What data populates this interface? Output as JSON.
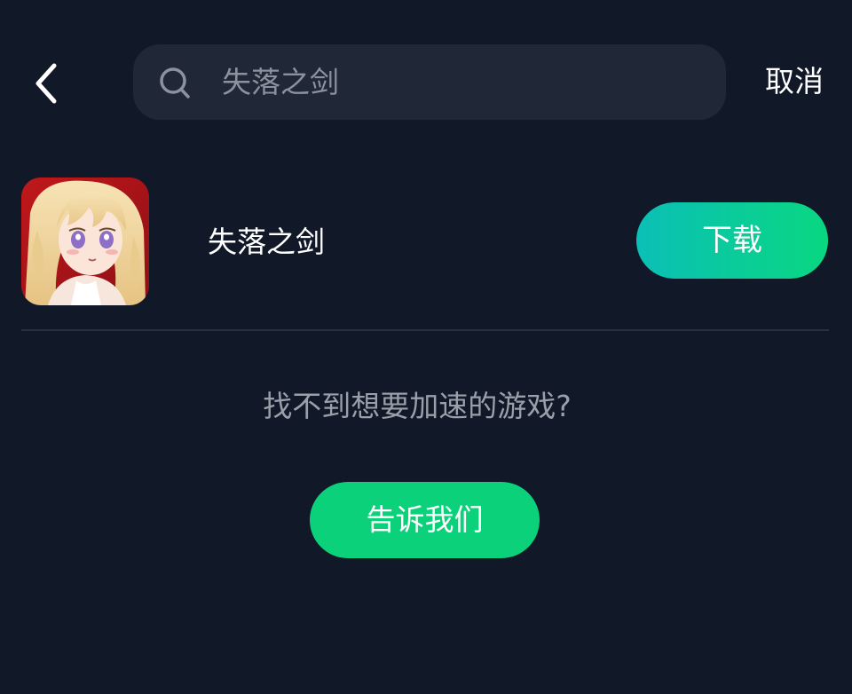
{
  "header": {
    "back_icon": "chevron-left-icon",
    "search": {
      "icon": "search-icon",
      "value": "失落之剑",
      "placeholder": ""
    },
    "cancel_label": "取消"
  },
  "results": [
    {
      "title": "失落之剑",
      "icon": "anime-character-game-icon",
      "action_label": "下载"
    }
  ],
  "empty_prompt": {
    "text": "找不到想要加速的游戏?",
    "button_label": "告诉我们"
  },
  "colors": {
    "background": "#111828",
    "search_bg": "#202737",
    "accent_green": "#0bd27a",
    "accent_teal": "#0bbfb6"
  }
}
